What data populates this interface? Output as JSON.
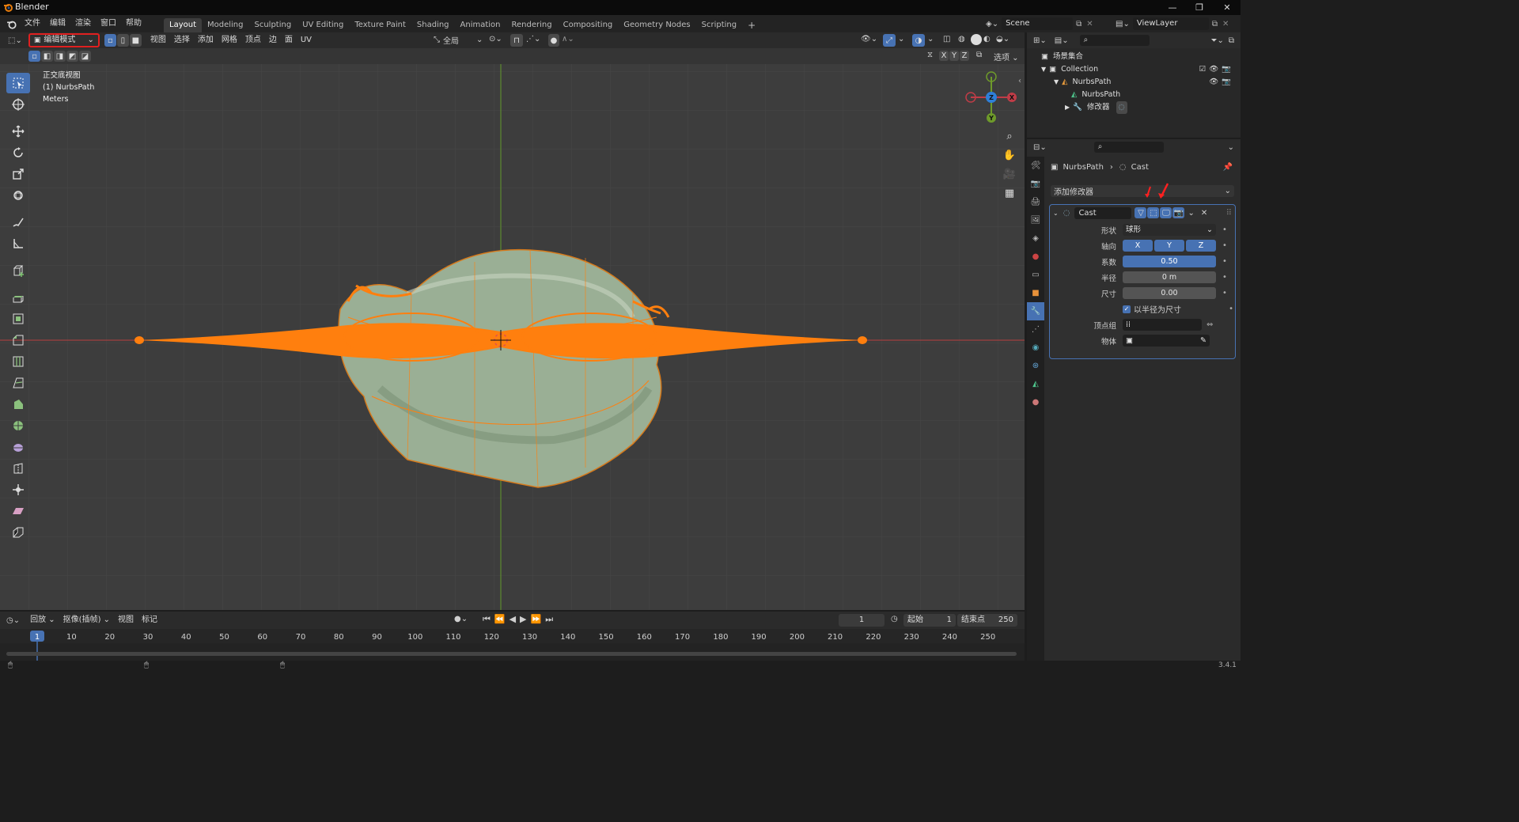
{
  "window": {
    "app_title": "Blender",
    "version": "3.4.1"
  },
  "topbar": {
    "menus": [
      "文件",
      "编辑",
      "渲染",
      "窗口",
      "帮助"
    ],
    "workspaces": [
      "Layout",
      "Modeling",
      "Sculpting",
      "UV Editing",
      "Texture Paint",
      "Shading",
      "Animation",
      "Rendering",
      "Compositing",
      "Geometry Nodes",
      "Scripting"
    ],
    "active_workspace": "Layout",
    "add_tab": "+",
    "scene": "Scene",
    "view_layer": "ViewLayer"
  },
  "viewport": {
    "mode": "编辑模式",
    "menus": [
      "视图",
      "选择",
      "添加",
      "网格",
      "顶点",
      "边",
      "面",
      "UV"
    ],
    "transform_orientation": "全局",
    "options_label": "选项",
    "axis_buttons": [
      "X",
      "Y",
      "Z"
    ],
    "overlay_info": {
      "view": "正交底视图",
      "object": "(1) NurbsPath",
      "units": "Meters"
    },
    "gizmo": {
      "x": "X",
      "y": "Y",
      "z": "Z"
    },
    "colors": {
      "selection": "#ff7f0e",
      "mesh": "#9aaf95",
      "grid_red": "#a04040",
      "grid_green": "#5c8a2e",
      "highlight_box": "#e02020"
    }
  },
  "outliner": {
    "root": "场景集合",
    "items": [
      {
        "label": "Collection",
        "level": 1
      },
      {
        "label": "NurbsPath",
        "level": 2
      },
      {
        "label": "NurbsPath",
        "level": 3
      },
      {
        "label": "修改器",
        "level": 3
      }
    ]
  },
  "properties": {
    "breadcrumb": {
      "object": "NurbsPath",
      "modifier": "Cast"
    },
    "add_modifier": "添加修改器",
    "modifier": {
      "name": "Cast",
      "fields": [
        {
          "label": "形状",
          "value": "球形",
          "type": "dropdown"
        },
        {
          "label": "轴向",
          "value": "",
          "type": "axes",
          "axes": [
            "X",
            "Y",
            "Z"
          ]
        },
        {
          "label": "系数",
          "value": "0.50",
          "type": "slider"
        },
        {
          "label": "半径",
          "value": "0 m",
          "type": "number"
        },
        {
          "label": "尺寸",
          "value": "0.00",
          "type": "number"
        }
      ],
      "checkbox": "以半径为尺寸",
      "vertex_group_label": "顶点组",
      "object_label": "物体"
    }
  },
  "timeline": {
    "menus": [
      "回放",
      "抠像(插帧)",
      "视图",
      "标记"
    ],
    "current_frame": "1",
    "start_label": "起始",
    "start": "1",
    "end_label": "结束点",
    "end": "250",
    "ruler": [
      "10",
      "20",
      "30",
      "40",
      "50",
      "60",
      "70",
      "80",
      "90",
      "100",
      "110",
      "120",
      "130",
      "140",
      "150",
      "160",
      "170",
      "180",
      "190",
      "200",
      "210",
      "220",
      "230",
      "240",
      "250"
    ],
    "playhead": "1"
  }
}
